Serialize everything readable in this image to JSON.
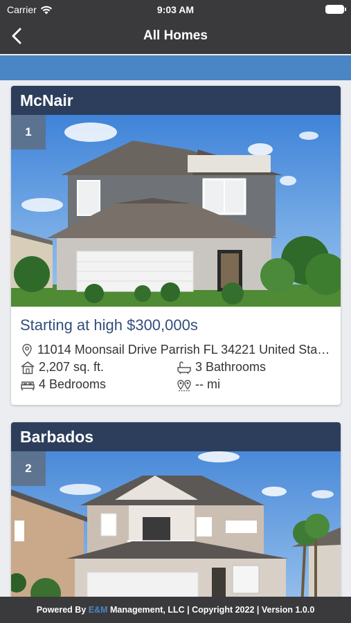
{
  "status_bar": {
    "carrier": "Carrier",
    "time": "9:03 AM"
  },
  "nav": {
    "title": "All Homes"
  },
  "homes": [
    {
      "name": "McNair",
      "index": "1",
      "price": "Starting at high $300,000s",
      "address": "11014 Moonsail Drive Parrish FL 34221 United States",
      "sqft": "2,207 sq. ft.",
      "bathrooms": "3 Bathrooms",
      "bedrooms": "4 Bedrooms",
      "distance": "-- mi"
    },
    {
      "name": "Barbados",
      "index": "2"
    }
  ],
  "footer": {
    "prefix": "Powered By ",
    "brand": "E&M",
    "suffix": " Management, LLC | Copyright 2022 | Version 1.0.0"
  },
  "colors": {
    "header_bar": "#3a3a3c",
    "accent": "#4a86c5",
    "card_header": "#2c3e5c",
    "price_text": "#344e7c"
  },
  "icons": [
    "wifi-icon",
    "battery-icon",
    "back-chevron-icon",
    "location-pin-icon",
    "house-icon",
    "bathtub-icon",
    "bed-icon",
    "distance-pins-icon"
  ]
}
